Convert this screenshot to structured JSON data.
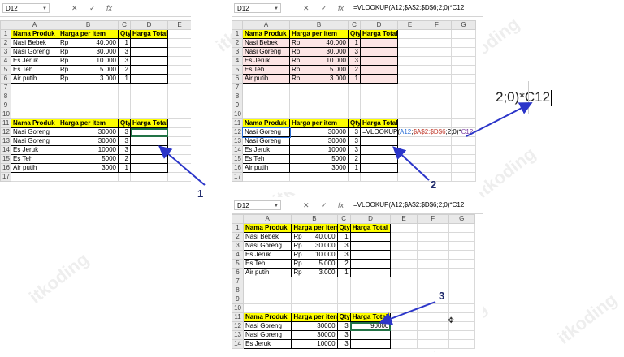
{
  "watermark": "itkoding",
  "columns": [
    "A",
    "B",
    "C",
    "D",
    "E"
  ],
  "columns_panel2": [
    "A",
    "B",
    "C",
    "D",
    "E",
    "F",
    "G"
  ],
  "columns_panel3": [
    "A",
    "B",
    "C",
    "D",
    "E",
    "F",
    "G"
  ],
  "table_header": [
    "Nama Produk",
    "Harga per item",
    "Qty",
    "Harga Total"
  ],
  "panel1": {
    "namebox": "D12",
    "formula": "",
    "top_rows": [
      {
        "row": "2",
        "produk": "Nasi Bebek",
        "cur": "Rp",
        "harga": "40.000",
        "qty": "1"
      },
      {
        "row": "3",
        "produk": "Nasi Goreng",
        "cur": "Rp",
        "harga": "30.000",
        "qty": "3"
      },
      {
        "row": "4",
        "produk": "Es Jeruk",
        "cur": "Rp",
        "harga": "10.000",
        "qty": "3"
      },
      {
        "row": "5",
        "produk": "Es Teh",
        "cur": "Rp",
        "harga": "5.000",
        "qty": "2"
      },
      {
        "row": "6",
        "produk": "Air putih",
        "cur": "Rp",
        "harga": "3.000",
        "qty": "1"
      }
    ],
    "bottom_rows": [
      {
        "row": "12",
        "produk": "Nasi Goreng",
        "harga": "30000",
        "qty": "3",
        "total": ""
      },
      {
        "row": "13",
        "produk": "Nasi Goreng",
        "harga": "30000",
        "qty": "3",
        "total": ""
      },
      {
        "row": "14",
        "produk": "Es Jeruk",
        "harga": "10000",
        "qty": "3",
        "total": ""
      },
      {
        "row": "15",
        "produk": "Es Teh",
        "harga": "5000",
        "qty": "2",
        "total": ""
      },
      {
        "row": "16",
        "produk": "Air putih",
        "harga": "3000",
        "qty": "1",
        "total": ""
      }
    ]
  },
  "panel2": {
    "namebox": "D12",
    "formula": "=VLOOKUP(A12;$A$2:$D$6;2;0)*C12",
    "cell_formula": "=VLOOKUP(A12;$A$2:$D$6;2;0)*C12"
  },
  "panel3": {
    "namebox": "D12",
    "formula": "=VLOOKUP(A12;$A$2:$D$6;2;0)*C12",
    "result": "90000"
  },
  "zoom_text": "2;0)*C12",
  "callouts": [
    "1",
    "2",
    "3"
  ],
  "colors": {
    "header_fill": "#ffff00",
    "range_highlight": "#fce4e4",
    "selection": "#217346",
    "arrow": "#2b35c9"
  }
}
